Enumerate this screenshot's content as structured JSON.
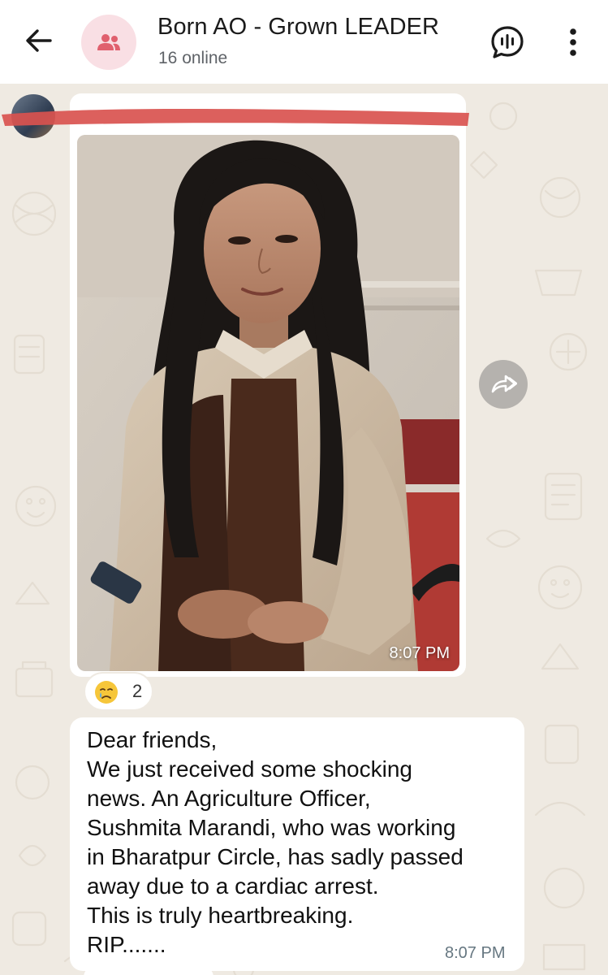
{
  "header": {
    "title": "Born AO - Grown LEADER",
    "subtitle": "16 online",
    "back_icon": "arrow-left-icon",
    "avatar_icon": "group-icon",
    "voice_chat_icon": "voice-chat-icon",
    "menu_icon": "more-vert-icon"
  },
  "colors": {
    "header_bg": "#ffffff",
    "chat_bg": "#efeae2",
    "avatar_bg": "#f9dfe4",
    "avatar_icon": "#e0606e",
    "redaction": "#d9534f"
  },
  "messages": [
    {
      "type": "image",
      "sender_name": "",
      "time": "8:07 PM",
      "reaction": {
        "emoji": "crying-face-icon",
        "count": "2"
      }
    },
    {
      "type": "text",
      "lines": [
        "Dear friends,",
        "We just received some shocking",
        "news. An Agriculture Officer,",
        "Sushmita Marandi, who was working",
        "in Bharatpur Circle, has sadly passed",
        "away due to a cardiac arrest.",
        "This is truly heartbreaking.",
        "RIP......."
      ],
      "time": "8:07 PM"
    }
  ],
  "forward_icon": "forward-icon"
}
